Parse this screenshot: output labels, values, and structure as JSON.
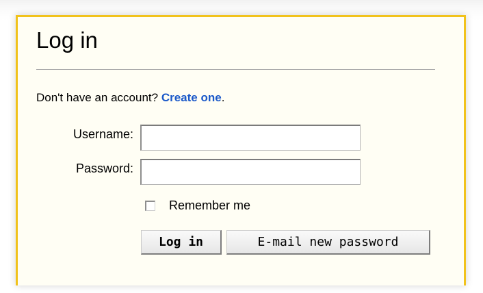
{
  "login_form": {
    "title": "Log in",
    "no_account_text": "Don't have an account? ",
    "create_link": "Create one",
    "create_suffix": ".",
    "username_label": "Username:",
    "username_value": "",
    "password_label": "Password:",
    "password_value": "",
    "remember_label": "Remember me",
    "remember_checked": false,
    "login_button": "Log in",
    "email_password_button": "E-mail new password"
  },
  "colors": {
    "panel_border": "#f1c21b",
    "panel_background": "#fffef4",
    "link": "#1b59c9"
  }
}
